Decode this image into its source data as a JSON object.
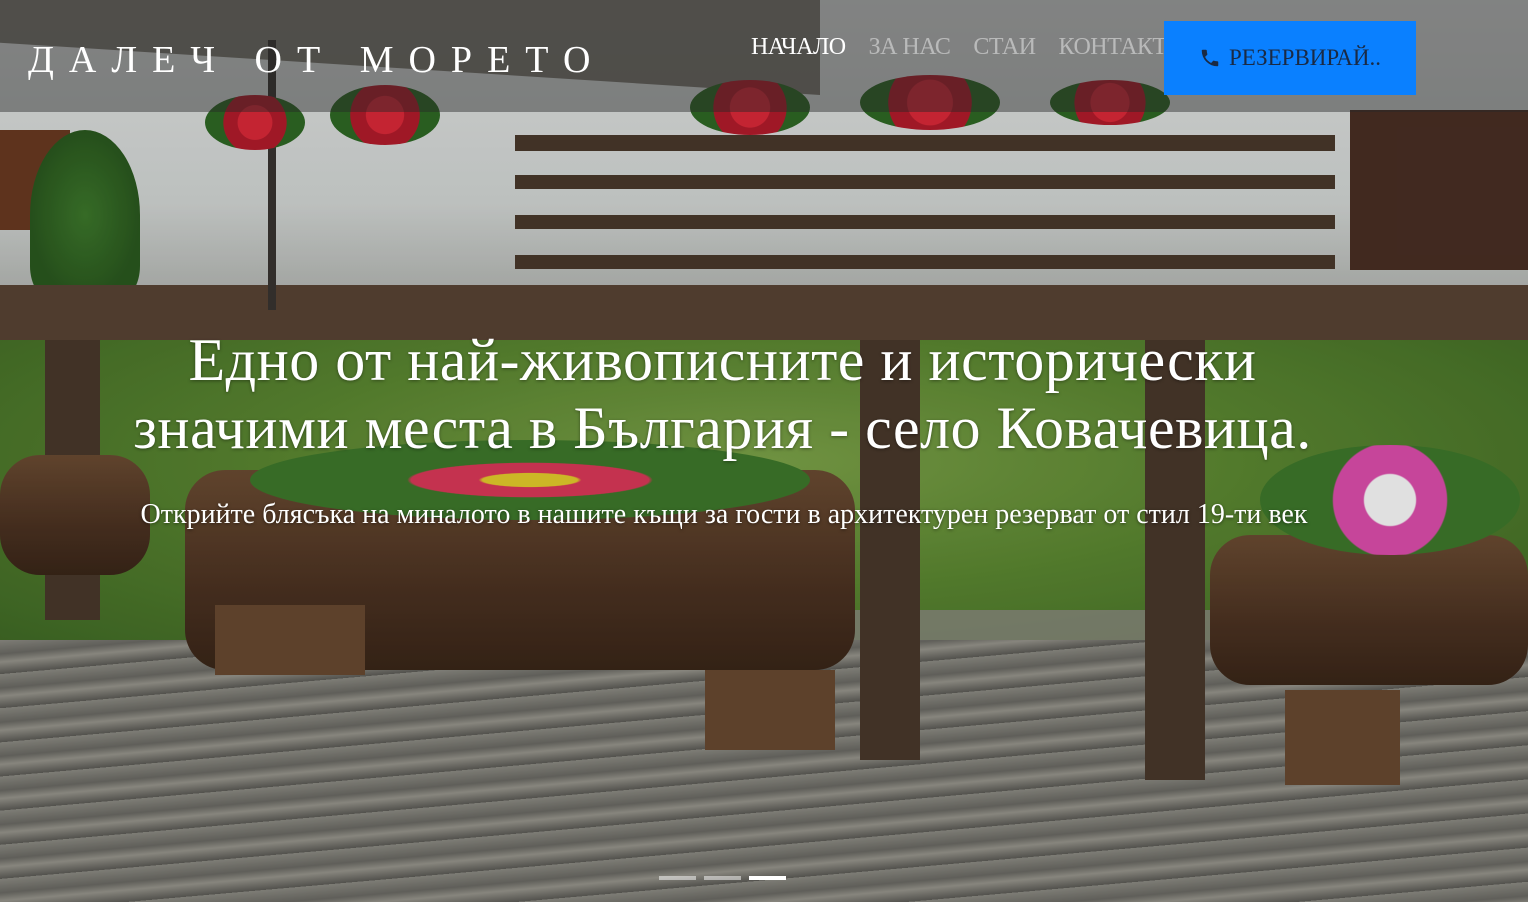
{
  "header": {
    "brand": "ДАЛЕЧ ОТ МОРЕТО",
    "nav": [
      {
        "label": "НАЧАЛО",
        "active": true
      },
      {
        "label": "ЗА НАС",
        "active": false
      },
      {
        "label": "СТАИ",
        "active": false
      },
      {
        "label": "КОНТАКТ",
        "active": false
      }
    ],
    "reserve_button": {
      "label": "РЕЗЕРВИРАЙ..",
      "icon": "phone-icon"
    }
  },
  "hero": {
    "headline_line1": "Едно от най-живописните и исторически",
    "headline_line2": "значими места в България - село Ковачевица.",
    "subtitle": "Открийте блясъка на миналото в нашите къщи за гости в архитектурен резерват от стил 19-ти век",
    "carousel": {
      "slides": 3,
      "active_index": 2
    }
  },
  "colors": {
    "accent": "#0a80ff",
    "nav_active": "#ffffff",
    "nav_inactive": "rgba(255,255,255,0.45)"
  }
}
